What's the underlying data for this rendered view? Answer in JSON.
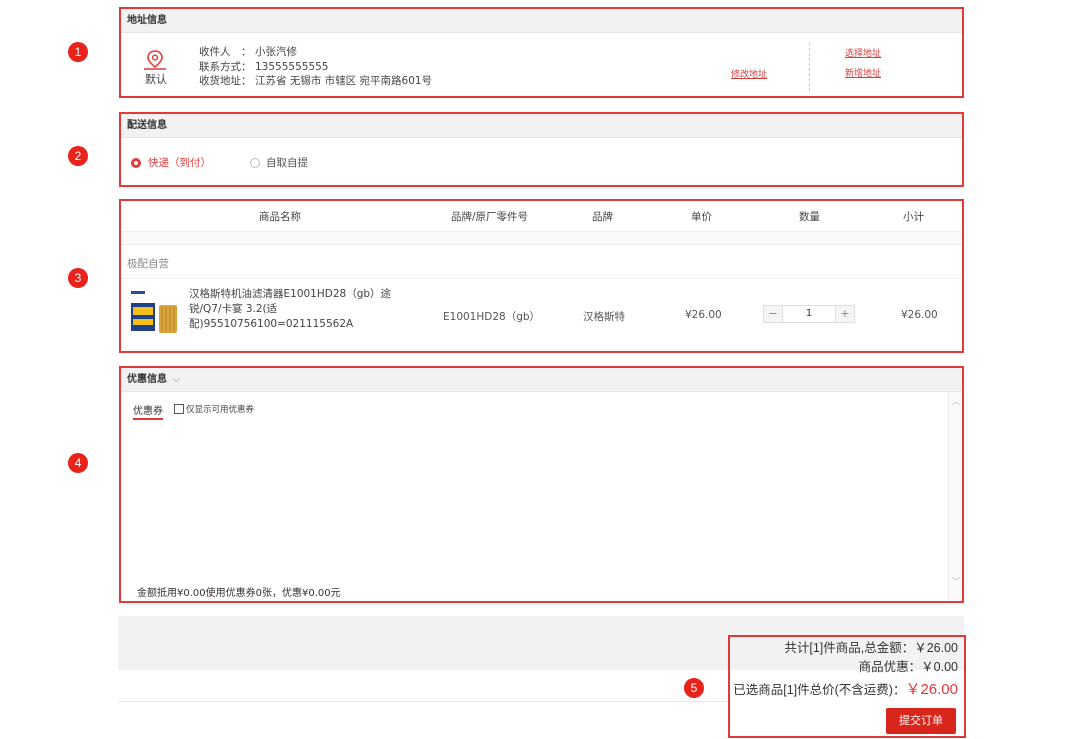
{
  "markers": [
    "1",
    "2",
    "3",
    "4",
    "5"
  ],
  "address": {
    "title": "地址信息",
    "default_label": "默认",
    "receiver_label": "收件人　：",
    "receiver": "小张汽修",
    "phone_label": "联系方式：",
    "phone": "13555555555",
    "addr_label": "收货地址：",
    "addr": "江苏省 无锡市 市辖区 宛平南路601号",
    "edit_link": "修改地址",
    "select_link": "选择地址",
    "new_link": "新增地址"
  },
  "delivery": {
    "title": "配送信息",
    "options": [
      {
        "label": "快递（到付）",
        "selected": true
      },
      {
        "label": "自取自提",
        "selected": false
      }
    ]
  },
  "products": {
    "headers": [
      "商品名称",
      "品牌/原厂零件号",
      "品牌",
      "单价",
      "数量",
      "小计"
    ],
    "shop": "极配自营",
    "item": {
      "name": "汉格斯特机油滤清器E1001HD28（gb）途锐/Q7/卡宴 3.2(适配)95510756100=021115562A",
      "part_no": "E1001HD28（gb）",
      "brand": "汉格斯特",
      "price": "¥26.00",
      "quantity": "1",
      "subtotal": "¥26.00"
    }
  },
  "coupon": {
    "title": "优惠信息",
    "tab": "优惠券",
    "only_available": "仅显示可用优惠券",
    "footer": "金额抵用¥0.00使用优惠券0张，优惠¥0.00元"
  },
  "summary": {
    "total_line": "共计[1]件商品,总金额：￥26.00",
    "discount_line": "商品优惠：￥0.00",
    "selected_label": "已选商品[1]件总价(不含运费)：",
    "selected_total": "￥26.00",
    "submit": "提交订单"
  },
  "colors": {
    "accent": "#e23a3a",
    "button": "#d8261c",
    "marker": "#e8231b"
  }
}
